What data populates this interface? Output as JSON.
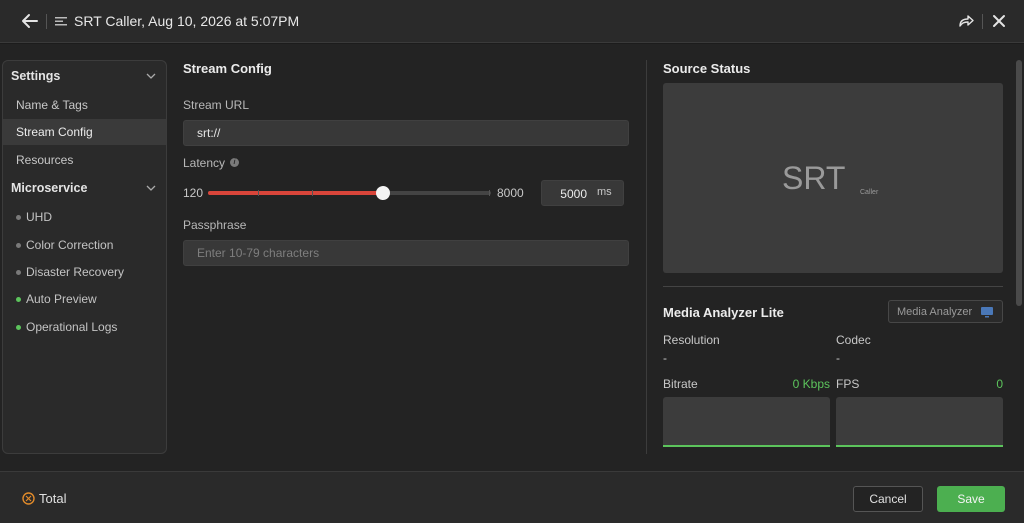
{
  "header": {
    "title": "SRT Caller, Aug 10, 2026 at 5:07PM"
  },
  "sidebar": {
    "sections": [
      {
        "label": "Settings"
      },
      {
        "label": "Microservice"
      }
    ],
    "settings_items": [
      {
        "label": "Name & Tags"
      },
      {
        "label": "Stream Config",
        "active": true
      },
      {
        "label": "Resources"
      }
    ],
    "microservice_items": [
      {
        "label": "UHD",
        "status": "inactive"
      },
      {
        "label": "Color Correction",
        "status": "inactive"
      },
      {
        "label": "Disaster Recovery",
        "status": "inactive"
      },
      {
        "label": "Auto Preview",
        "status": "active"
      },
      {
        "label": "Operational Logs",
        "status": "active"
      }
    ]
  },
  "stream_config": {
    "title": "Stream Config",
    "url_label": "Stream URL",
    "url_value": "srt://",
    "latency_label": "Latency",
    "latency_min": "120",
    "latency_max": "8000",
    "latency_value": "5000",
    "latency_unit": "ms",
    "latency_fraction": 0.62,
    "passphrase_label": "Passphrase",
    "passphrase_placeholder": "Enter 10-79 characters"
  },
  "source_status": {
    "title": "Source Status",
    "logo_text": "SRT",
    "logo_subtext": "Caller"
  },
  "media_analyzer": {
    "title": "Media Analyzer Lite",
    "button_label": "Media Analyzer",
    "resolution_label": "Resolution",
    "resolution_value": "-",
    "codec_label": "Codec",
    "codec_value": "-",
    "bitrate_label": "Bitrate",
    "bitrate_value": "0 Kbps",
    "fps_label": "FPS",
    "fps_value": "0"
  },
  "footer": {
    "total_label": "Total",
    "cancel_label": "Cancel",
    "save_label": "Save"
  },
  "colors": {
    "accent_green": "#4caf50",
    "slider_red": "#d9453a",
    "status_green": "#5cc45c"
  }
}
